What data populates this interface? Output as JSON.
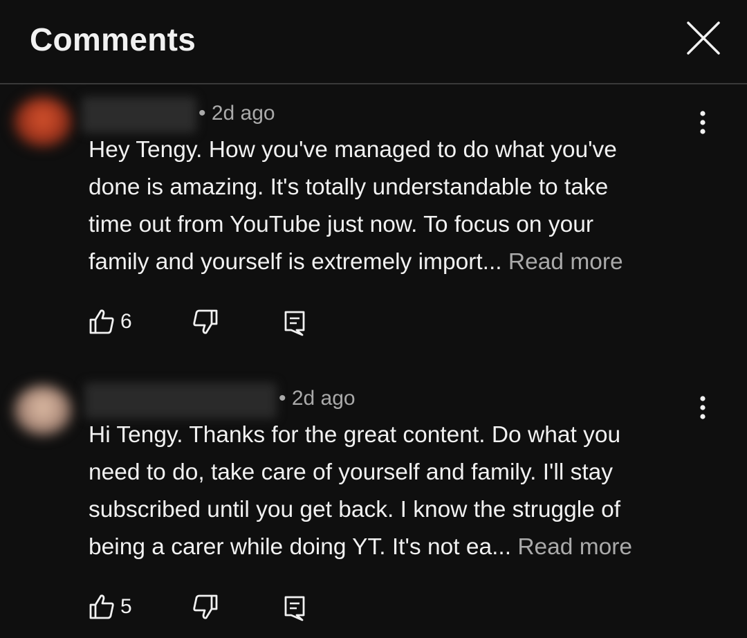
{
  "header": {
    "title": "Comments",
    "close_icon": "close-icon"
  },
  "comments": [
    {
      "time": "• 2d ago",
      "text": "Hey Tengy. How you've managed to do what you've\ndone is amazing. It's totally understandable to take\ntime out from YouTube just now. To focus on your\nfamily and yourself is extremely import... ",
      "read_more": "Read more",
      "likes": "6",
      "avatar_color": "#c4452a"
    },
    {
      "time": "• 2d ago",
      "text": "Hi Tengy. Thanks for the great content. Do what you\nneed to do, take care of yourself and family. I'll stay\nsubscribed until you get back. I know the struggle of\nbeing a carer while doing YT. It's not ea... ",
      "read_more": "Read more",
      "likes": "5",
      "avatar_color": "#b89886"
    }
  ],
  "colors": {
    "background": "#0f0f0f",
    "text": "#f1f1f1",
    "secondary": "#aaaaaa",
    "divider": "#3a3a3a"
  }
}
